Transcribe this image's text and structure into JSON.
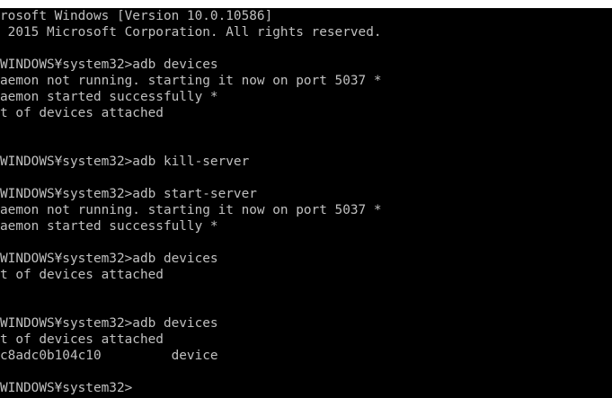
{
  "console": {
    "lines": [
      "rosoft Windows [Version 10.0.10586]",
      " 2015 Microsoft Corporation. All rights reserved.",
      "",
      "WINDOWS¥system32>adb devices",
      "aemon not running. starting it now on port 5037 *",
      "aemon started successfully *",
      "t of devices attached",
      "",
      "",
      "WINDOWS¥system32>adb kill-server",
      "",
      "WINDOWS¥system32>adb start-server",
      "aemon not running. starting it now on port 5037 *",
      "aemon started successfully *",
      "",
      "WINDOWS¥system32>adb devices",
      "t of devices attached",
      "",
      "",
      "WINDOWS¥system32>adb devices",
      "t of devices attached",
      "c8adc0b104c10         device",
      "",
      "WINDOWS¥system32>"
    ]
  },
  "colors": {
    "background": "#000000",
    "text": "#c0c0c0",
    "top_strip": "#ffffff"
  }
}
